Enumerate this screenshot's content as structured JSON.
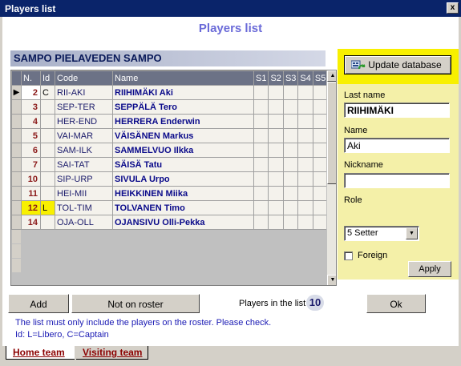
{
  "window": {
    "title": "Players list",
    "close_glyph": "x"
  },
  "heading": "Players list",
  "team_name": "SAMPO PIELAVEDEN SAMPO",
  "grid": {
    "columns": [
      "N.",
      "Id",
      "Code",
      "Name",
      "S1",
      "S2",
      "S3",
      "S4",
      "S5"
    ],
    "rows": [
      {
        "num": "2",
        "id": "C",
        "code": "RII-AKI",
        "name": "RIIHIMÄKI Aki",
        "selected": true
      },
      {
        "num": "3",
        "id": "",
        "code": "SEP-TER",
        "name": "SEPPÄLÄ Tero"
      },
      {
        "num": "4",
        "id": "",
        "code": "HER-END",
        "name": "HERRERA Enderwin"
      },
      {
        "num": "5",
        "id": "",
        "code": "VAI-MAR",
        "name": "VÄISÄNEN Markus"
      },
      {
        "num": "6",
        "id": "",
        "code": "SAM-ILK",
        "name": "SAMMELVUO Ilkka"
      },
      {
        "num": "7",
        "id": "",
        "code": "SAI-TAT",
        "name": "SÄISÄ Tatu"
      },
      {
        "num": "10",
        "id": "",
        "code": "SIP-URP",
        "name": "SIVULA Urpo"
      },
      {
        "num": "11",
        "id": "",
        "code": "HEI-MII",
        "name": "HEIKKINEN Miika"
      },
      {
        "num": "12",
        "id": "L",
        "code": "TOL-TIM",
        "name": "TOLVANEN Timo",
        "libero": true
      },
      {
        "num": "14",
        "id": "",
        "code": "OJA-OLL",
        "name": "OJANSIVU Olli-Pekka"
      }
    ]
  },
  "panel": {
    "update_button": "Update database",
    "last_name_label": "Last name",
    "last_name_value": "RIIHIMÄKI",
    "name_label": "Name",
    "name_value": "Aki",
    "nickname_label": "Nickname",
    "nickname_value": "",
    "role_label": "Role",
    "role_value": "5 Setter",
    "foreign_label": "Foreign",
    "apply_button": "Apply"
  },
  "footer": {
    "add_button": "Add",
    "not_on_roster_button": "Not on roster",
    "players_count_label": "Players in the list",
    "players_count": "10",
    "ok_button": "Ok",
    "note_line1": "The list must only include the players on the roster. Please check.",
    "note_line2": "Id: L=Libero, C=Captain"
  },
  "tabs": [
    "Home team",
    "Visiting team"
  ],
  "colors": {
    "titlebar": "#0a246a",
    "highlight": "#f8f000",
    "heading": "#6a6ad8"
  }
}
